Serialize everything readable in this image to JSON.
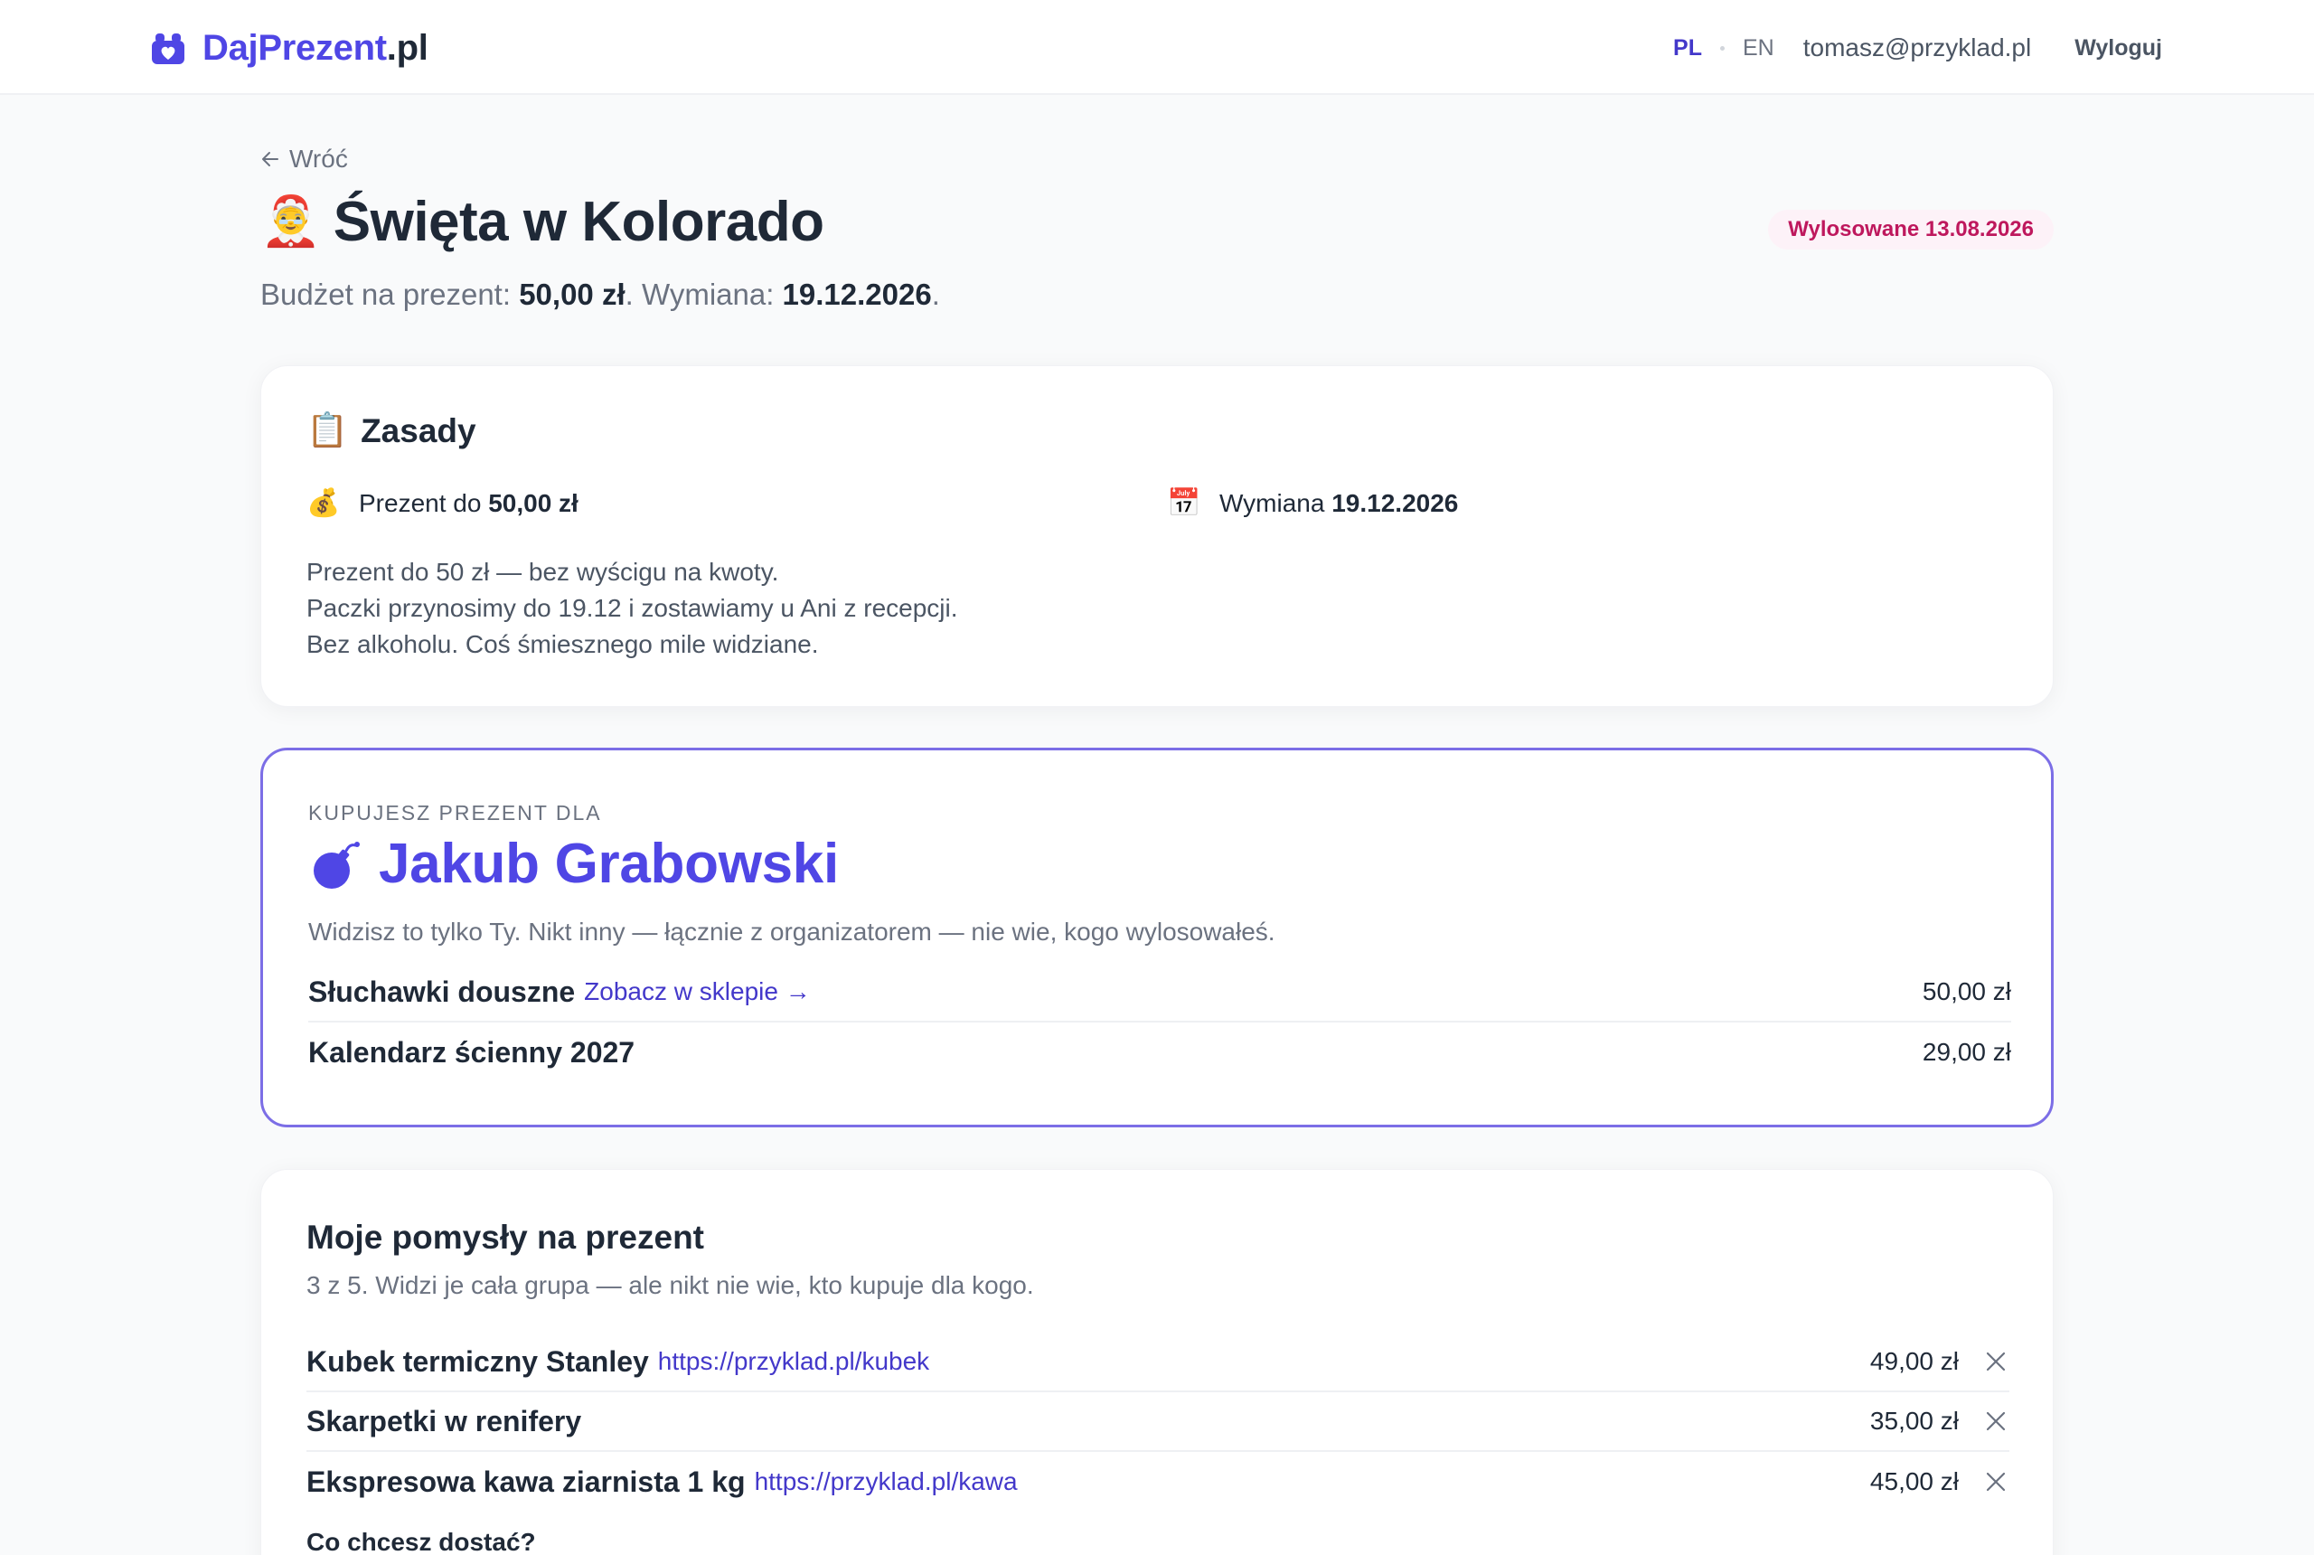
{
  "header": {
    "brand_part1": "DajPrezent",
    "brand_part2": ".pl",
    "lang_active": "PL",
    "lang_other": "EN",
    "user_email": "tomasz@przyklad.pl",
    "logout_label": "Wyloguj"
  },
  "page": {
    "back_label": "Wróć",
    "title_emoji": "🤶",
    "title": "Święta w Kolorado",
    "drawn_badge": "Wylosowane 13.08.2026",
    "budget_label": "Budżet na prezent:",
    "budget_value": "50,00 zł",
    "exchange_label": "Wymiana:",
    "exchange_value": "19.12.2026"
  },
  "rules": {
    "emoji": "📋",
    "heading": "Zasady",
    "budget_emoji": "💰",
    "budget_prefix": "Prezent do",
    "budget_value": "50,00 zł",
    "date_emoji": "📅",
    "date_prefix": "Wymiana",
    "date_value": "19.12.2026",
    "lines": [
      "Prezent do 50 zł — bez wyścigu na kwoty.",
      "Paczki przynosimy do 19.12 i zostawiamy u Ani z recepcji.",
      "Bez alkoholu. Coś śmiesznego mile widziane."
    ]
  },
  "target": {
    "eyebrow": "KUPUJESZ PREZENT DLA",
    "name": "Jakub Grabowski",
    "note": "Widzisz to tylko Ty. Nikt inny — łącznie z organizatorem — nie wie, kogo wylosowałeś.",
    "wishes": [
      {
        "name": "Słuchawki douszne",
        "link": "Zobacz w sklepie →",
        "price": "50,00 zł"
      },
      {
        "name": "Kalendarz ścienny 2027",
        "link": "",
        "price": "29,00 zł"
      }
    ]
  },
  "ideas": {
    "heading": "Moje pomysły na prezent",
    "subtitle": "3 z 5. Widzi je cała grupa — ale nikt nie wie, kto kupuje dla kogo.",
    "items": [
      {
        "name": "Kubek termiczny Stanley",
        "link": "https://przyklad.pl/kubek",
        "price": "49,00 zł"
      },
      {
        "name": "Skarpetki w renifery",
        "link": "",
        "price": "35,00 zł"
      },
      {
        "name": "Ekspresowa kawa ziarnista 1 kg",
        "link": "https://przyklad.pl/kawa",
        "price": "45,00 zł"
      }
    ],
    "form_label": "Co chcesz dostać?"
  },
  "colors": {
    "brand": "#4f46e5",
    "badge_text": "#be185d",
    "badge_bg": "#fdf2f8",
    "target_border": "#7c6ee6"
  }
}
